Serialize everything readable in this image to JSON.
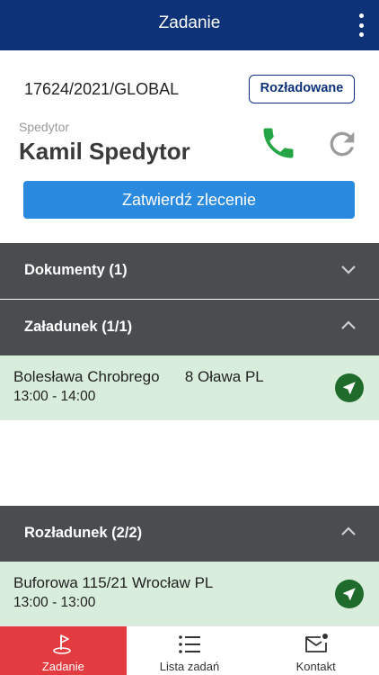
{
  "header": {
    "title": "Zadanie",
    "menu_icon": "more-vert-icon"
  },
  "order": {
    "number": "17624/2021/GLOBAL",
    "status": "Rozładowane"
  },
  "forwarder": {
    "label": "Spedytor",
    "name": "Kamil Spedytor",
    "phone_icon": "phone-icon",
    "refresh_icon": "refresh-icon"
  },
  "confirm_button": {
    "label": "Zatwierdź zlecenie"
  },
  "sections": {
    "documents": {
      "title": "Dokumenty (1)",
      "expanded": false
    },
    "loading": {
      "title": "Załadunek (1/1)",
      "expanded": true,
      "stops": [
        {
          "address": "Bolesława Chrobrego      8 Oława PL",
          "time": "13:00 - 14:00"
        }
      ]
    },
    "unloading": {
      "title": "Rozładunek (2/2)",
      "expanded": true,
      "stops": [
        {
          "address": "Buforowa 115/21 Wrocław PL",
          "time": "13:00 - 13:00"
        }
      ]
    }
  },
  "bottom_nav": [
    {
      "label": "Zadanie",
      "icon": "flag-icon",
      "active": true
    },
    {
      "label": "Lista zadań",
      "icon": "list-icon",
      "active": false
    },
    {
      "label": "Kontakt",
      "icon": "mail-icon",
      "active": false
    }
  ],
  "colors": {
    "primary": "#0d3278",
    "accent_blue": "#2a8ae0",
    "section_bg": "#4a4d50",
    "stop_bg": "#d8eddb",
    "phone_green": "#25a545",
    "nav_active": "#e23b40"
  }
}
